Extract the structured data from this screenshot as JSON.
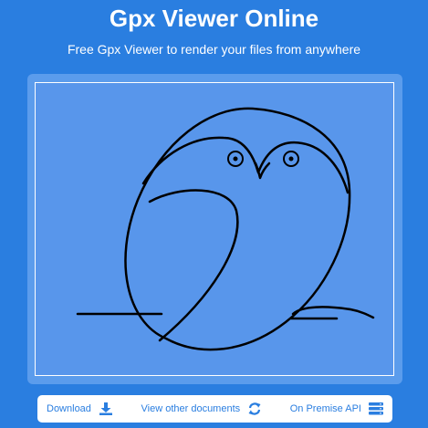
{
  "header": {
    "title": "Gpx Viewer Online",
    "subtitle": "Free Gpx Viewer to render your files from anywhere"
  },
  "viewer": {
    "track_color": "#000000",
    "background_color": "#5896eb"
  },
  "toolbar": {
    "buttons": [
      {
        "label": "Download",
        "icon": "download-icon"
      },
      {
        "label": "View other documents",
        "icon": "refresh-icon"
      },
      {
        "label": "On Premise API",
        "icon": "server-icon"
      }
    ]
  },
  "colors": {
    "page_background": "#2a7ee0",
    "panel_background": "#5b9cec",
    "accent": "#2a7ee0",
    "toolbar_background": "#ffffff"
  }
}
